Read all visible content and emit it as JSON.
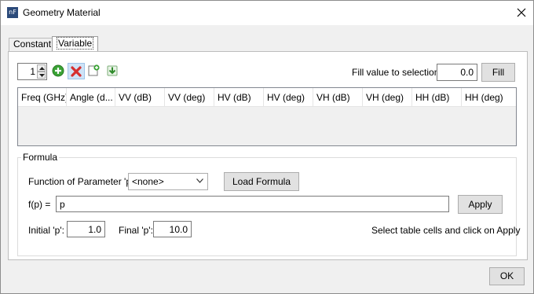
{
  "window": {
    "title": "Geometry Material",
    "app_icon_text": "nF",
    "close_icon": "close-icon"
  },
  "tabs": [
    {
      "label": "Constant",
      "active": false
    },
    {
      "label": "Variable",
      "active": true
    }
  ],
  "toolbar": {
    "row_count": "1",
    "icons": [
      "add-row-icon",
      "delete-row-icon",
      "new-document-icon",
      "download-icon"
    ]
  },
  "fill": {
    "label": "Fill value to selection:",
    "value": "0.0",
    "button": "Fill"
  },
  "table": {
    "columns": [
      "Freq (GHz)",
      "Angle (d...",
      "VV (dB)",
      "VV (deg)",
      "HV (dB)",
      "HV (deg)",
      "VH (dB)",
      "VH (deg)",
      "HH (dB)",
      "HH (deg)"
    ],
    "rows": []
  },
  "formula": {
    "group_title": "Formula",
    "function_label": "Function of Parameter 'p':",
    "function_value": "<none>",
    "load_button": "Load Formula",
    "fp_label": "f(p) =",
    "fp_value": "p",
    "apply_button": "Apply",
    "initial_label": "Initial 'p':",
    "initial_value": "1.0",
    "final_label": "Final 'p':",
    "final_value": "10.0",
    "hint": "Select table cells and click on Apply"
  },
  "footer": {
    "ok_button": "OK"
  },
  "colors": {
    "accent_green": "#3aa335",
    "delete_red": "#d62f2f",
    "window_bg": "#f0f0f0"
  }
}
